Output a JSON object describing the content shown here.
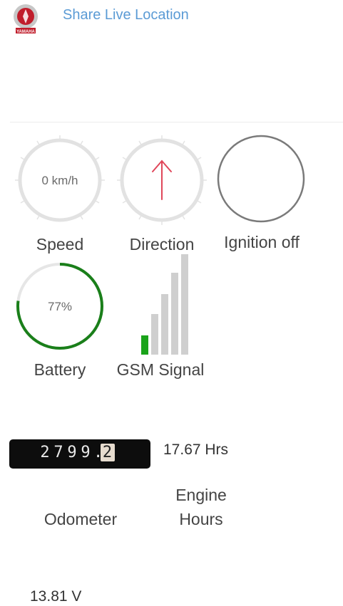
{
  "header": {
    "share_label": "Share Live Location",
    "logo_text": "YAMAHA"
  },
  "gauges": {
    "speed": {
      "value": "0 km/h",
      "label": "Speed"
    },
    "direction": {
      "label": "Direction",
      "arrow": "up-arrow"
    },
    "ignition": {
      "label": "Ignition off"
    },
    "battery": {
      "value": "77%",
      "percent": 77,
      "label": "Battery"
    },
    "gsm": {
      "label": "GSM Signal",
      "bars_total": 5,
      "bars_active": 1
    }
  },
  "odometer": {
    "digits": [
      "2",
      "7",
      "9",
      "9"
    ],
    "decimal": "2",
    "label": "Odometer"
  },
  "engine_hours": {
    "value": "17.67 Hrs",
    "label_line1": "Engine",
    "label_line2": "Hours"
  },
  "voltage": {
    "value": "13.81 V"
  },
  "colors": {
    "link": "#5b9bd5",
    "battery_arc": "#1a7f1a",
    "gsm_active": "#1aa31a",
    "arrow": "#e0475a"
  }
}
